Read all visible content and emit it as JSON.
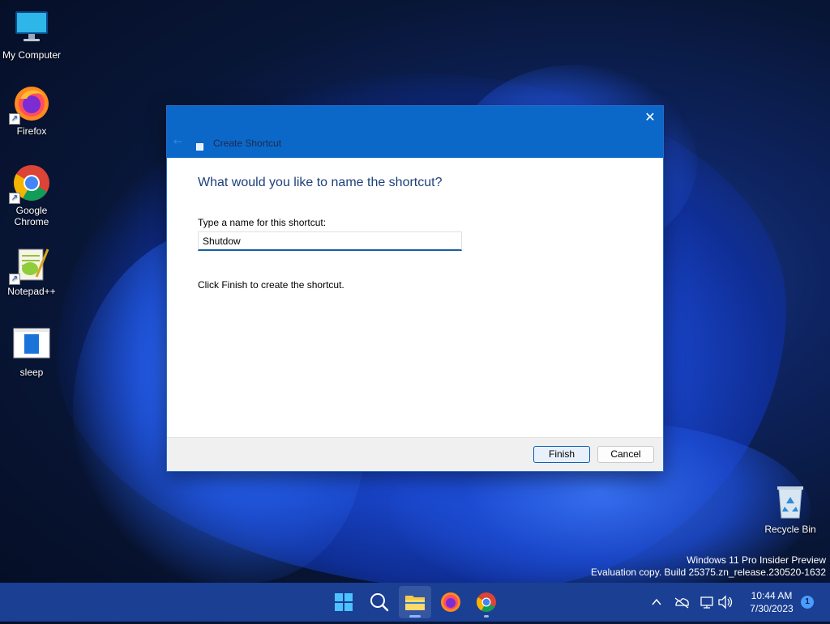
{
  "desktop": {
    "icons": [
      {
        "label": "My Computer"
      },
      {
        "label": "Firefox"
      },
      {
        "label": "Google Chrome"
      },
      {
        "label": "Notepad++"
      },
      {
        "label": "sleep"
      },
      {
        "label": "Recycle Bin"
      }
    ]
  },
  "dialog": {
    "title": "Create Shortcut",
    "heading": "What would you like to name the shortcut?",
    "field_label": "Type a name for this shortcut:",
    "field_value": "Shutdow",
    "hint": "Click Finish to create the shortcut.",
    "finish_label": "Finish",
    "cancel_label": "Cancel"
  },
  "watermark": {
    "line1": "Windows 11 Pro Insider Preview",
    "line2": "Evaluation copy. Build 25375.zn_release.230520-1632"
  },
  "taskbar": {
    "time": "10:44 AM",
    "date": "7/30/2023",
    "notification_count": "1",
    "pinned": [
      "start-icon",
      "search-icon",
      "file-explorer-icon",
      "firefox-icon",
      "chrome-icon"
    ]
  },
  "colors": {
    "accent": "#0c68c8",
    "taskbar": "#1a3f93",
    "heading_text": "#1e3f7a"
  }
}
